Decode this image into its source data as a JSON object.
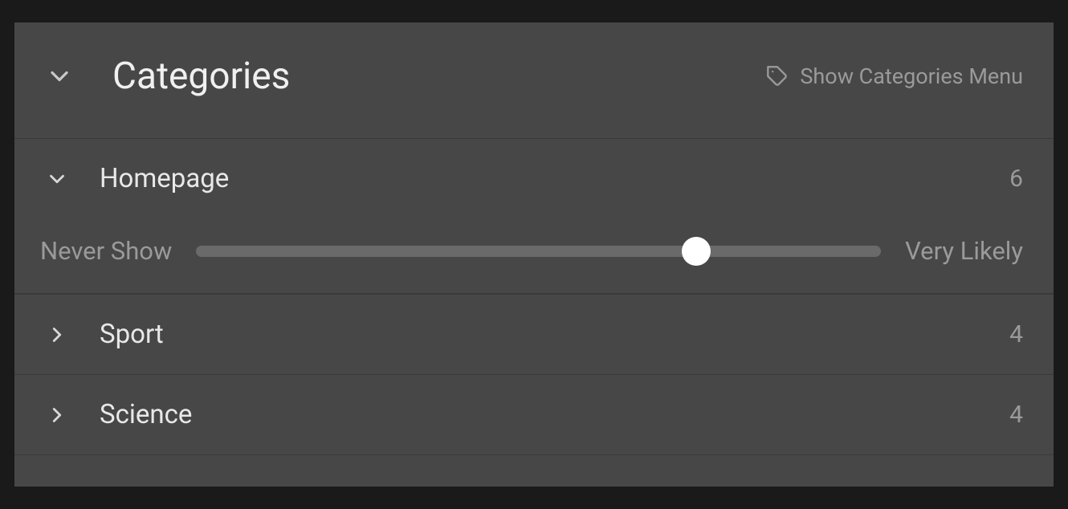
{
  "header": {
    "title": "Categories",
    "menuLink": "Show Categories Menu"
  },
  "slider": {
    "leftLabel": "Never Show",
    "rightLabel": "Very Likely",
    "value": 73
  },
  "categories": [
    {
      "label": "Homepage",
      "count": "6",
      "expanded": true
    },
    {
      "label": "Sport",
      "count": "4",
      "expanded": false
    },
    {
      "label": "Science",
      "count": "4",
      "expanded": false
    }
  ]
}
